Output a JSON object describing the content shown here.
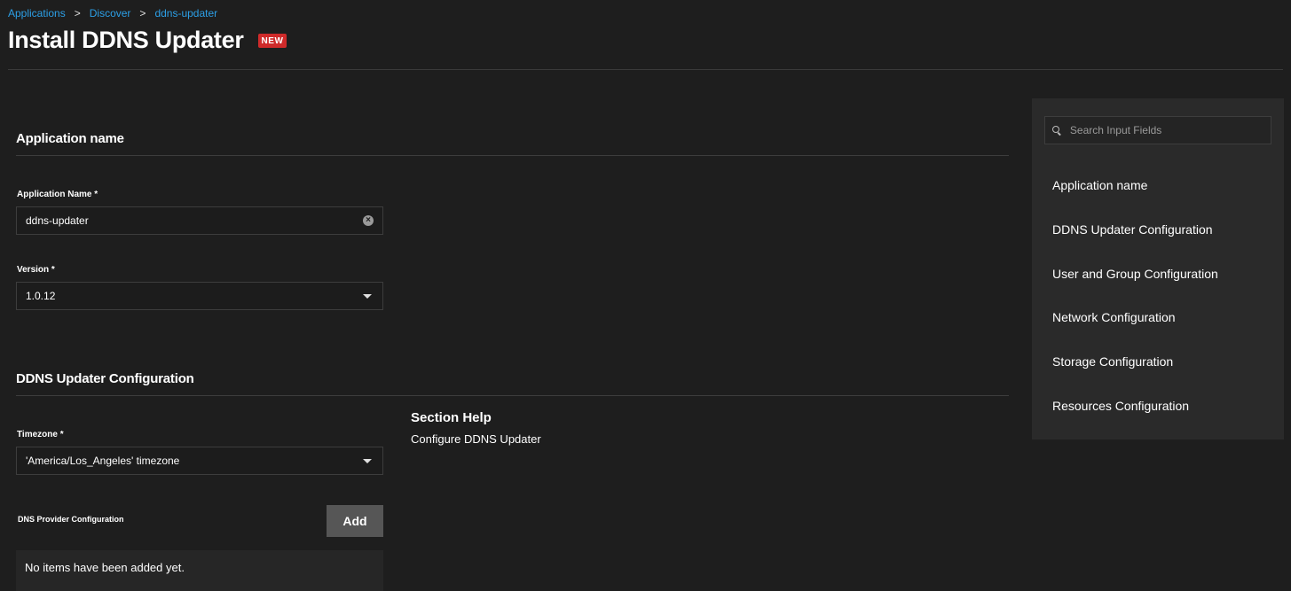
{
  "breadcrumb": [
    "Applications",
    "Discover",
    "ddns-updater"
  ],
  "breadcrumb_sep": ">",
  "page": {
    "title": "Install DDNS Updater",
    "badge": "NEW"
  },
  "sections": {
    "app_name": {
      "title": "Application name",
      "name_label": "Application Name *",
      "name_value": "ddns-updater",
      "version_label": "Version *",
      "version_value": "1.0.12"
    },
    "ddns": {
      "title": "DDNS Updater Configuration",
      "timezone_label": "Timezone *",
      "timezone_value": "'America/Los_Angeles' timezone",
      "dns_label": "DNS Provider Configuration",
      "add_label": "Add",
      "empty_text": "No items have been added yet.",
      "help_title": "Section Help",
      "help_text": "Configure DDNS Updater"
    }
  },
  "sidebar": {
    "search_placeholder": "Search Input Fields",
    "items": [
      "Application name",
      "DDNS Updater Configuration",
      "User and Group Configuration",
      "Network Configuration",
      "Storage Configuration",
      "Resources Configuration"
    ]
  },
  "colors": {
    "accent": "#2c9fe6",
    "badge": "#cf2a2a",
    "background": "#1e1e1e",
    "panel": "#2a2a2a"
  },
  "icons": [
    "search-icon",
    "clear-icon",
    "chevron-down-icon"
  ]
}
